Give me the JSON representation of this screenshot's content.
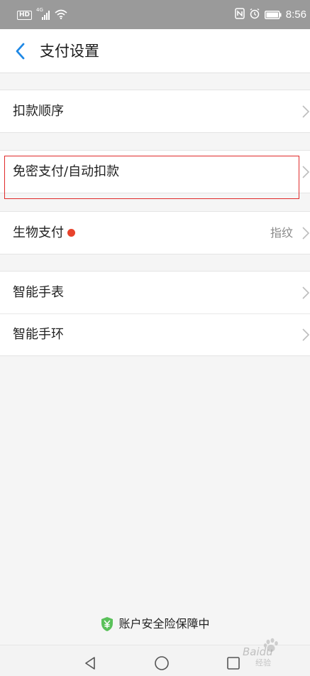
{
  "status_bar": {
    "hd_badge": "HD",
    "network": "4G",
    "time": "8:56",
    "icons": [
      "hd-icon",
      "signal-icon",
      "wifi-icon",
      "nfc-icon",
      "alarm-icon",
      "battery-icon"
    ]
  },
  "header": {
    "title": "支付设置",
    "back_icon": "chevron-left-icon",
    "accent_color": "#1e88e5"
  },
  "groups": [
    {
      "rows": [
        {
          "label": "扣款顺序",
          "value": ""
        }
      ]
    },
    {
      "rows": [
        {
          "label": "免密支付/自动扣款",
          "value": "",
          "highlighted": true
        }
      ]
    },
    {
      "rows": [
        {
          "label": "生物支付",
          "value": "指纹",
          "badge": "red-dot",
          "badge_color": "#e8432c"
        }
      ]
    },
    {
      "rows": [
        {
          "label": "智能手表",
          "value": ""
        },
        {
          "label": "智能手环",
          "value": ""
        }
      ]
    }
  ],
  "footer": {
    "security_text": "账户安全险保障中",
    "shield_icon": "shield-yuan-icon",
    "shield_color": "#5ac15a"
  },
  "nav_bar": {
    "buttons": [
      "back-triangle-icon",
      "home-circle-icon",
      "recents-square-icon"
    ]
  },
  "watermark": {
    "text": "Baidu",
    "sub": "经验"
  }
}
